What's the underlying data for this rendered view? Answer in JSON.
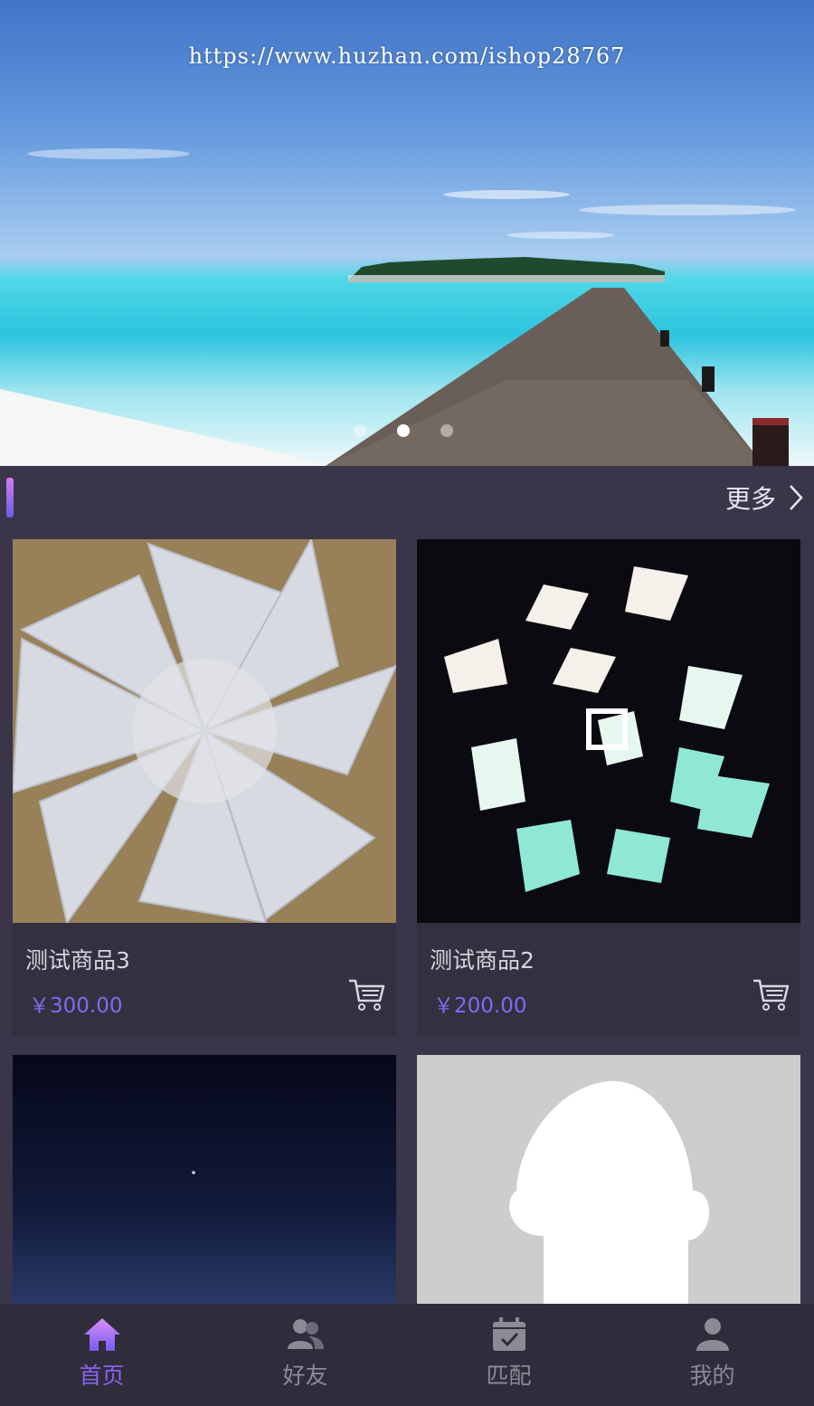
{
  "banner": {
    "watermark": "https://www.huzhan.com/ishop28767",
    "slides": 3,
    "active_slide": 2
  },
  "section": {
    "more_label": "更多"
  },
  "products": [
    {
      "name": "测试商品3",
      "price": "￥300.00"
    },
    {
      "name": "测试商品2",
      "price": "￥200.00"
    }
  ],
  "tabs": [
    {
      "label": "首页",
      "icon": "home-icon",
      "active": true
    },
    {
      "label": "好友",
      "icon": "friends-icon",
      "active": false
    },
    {
      "label": "匹配",
      "icon": "calendar-check-icon",
      "active": false
    },
    {
      "label": "我的",
      "icon": "user-icon",
      "active": false
    }
  ],
  "colors": {
    "accent": "#8a63f2",
    "price": "#7f6bf0",
    "background": "#3a3548",
    "tabbar": "#2f2c3b"
  }
}
